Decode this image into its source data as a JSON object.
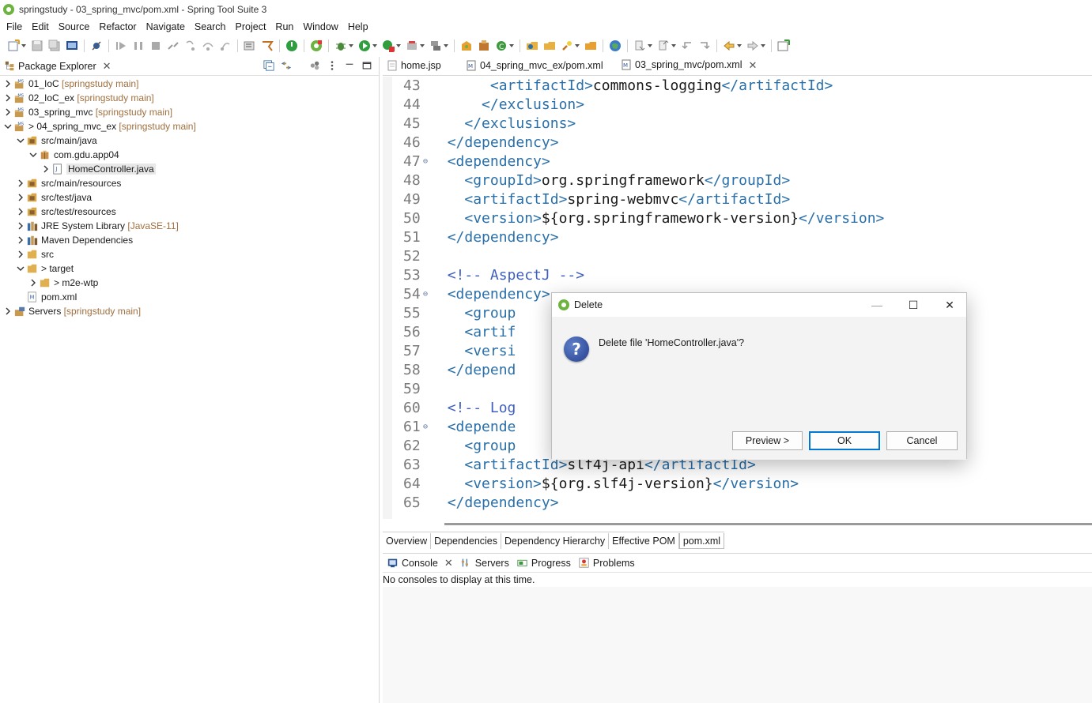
{
  "window": {
    "title": "springstudy - 03_spring_mvc/pom.xml - Spring Tool Suite 3"
  },
  "menu": [
    "File",
    "Edit",
    "Source",
    "Refactor",
    "Navigate",
    "Search",
    "Project",
    "Run",
    "Window",
    "Help"
  ],
  "package_explorer": {
    "tab_label": "Package Explorer",
    "items": [
      {
        "chevron": "›",
        "name": "01_IoC",
        "decor": " [springstudy main]",
        "icon": "maven-project-icon",
        "indent": 0
      },
      {
        "chevron": "›",
        "name": "02_IoC_ex",
        "decor": " [springstudy main]",
        "icon": "maven-project-icon",
        "indent": 0
      },
      {
        "chevron": "›",
        "name": "03_spring_mvc",
        "decor": " [springstudy main]",
        "icon": "maven-project-icon",
        "indent": 0
      },
      {
        "chevron": "⌄",
        "name": "> 04_spring_mvc_ex",
        "decor": " [springstudy main]",
        "icon": "maven-project-icon",
        "indent": 0
      },
      {
        "chevron": "⌄",
        "name": "src/main/java",
        "decor": "",
        "icon": "source-folder-icon",
        "indent": 1
      },
      {
        "chevron": "⌄",
        "name": "com.gdu.app04",
        "decor": "",
        "icon": "package-icon",
        "indent": 2
      },
      {
        "chevron": "›",
        "name": "HomeController.java",
        "decor": "",
        "icon": "java-file-icon",
        "indent": 3,
        "selected": true
      },
      {
        "chevron": "›",
        "name": "src/main/resources",
        "decor": "",
        "icon": "source-folder-icon",
        "indent": 1
      },
      {
        "chevron": "›",
        "name": "src/test/java",
        "decor": "",
        "icon": "source-folder-icon",
        "indent": 1
      },
      {
        "chevron": "›",
        "name": "src/test/resources",
        "decor": "",
        "icon": "source-folder-icon",
        "indent": 1
      },
      {
        "chevron": "›",
        "name": "JRE System Library",
        "decor": " [JavaSE-11]",
        "icon": "library-icon",
        "indent": 1
      },
      {
        "chevron": "›",
        "name": "Maven Dependencies",
        "decor": "",
        "icon": "library-icon",
        "indent": 1
      },
      {
        "chevron": "›",
        "name": "src",
        "decor": "",
        "icon": "folder-icon",
        "indent": 1
      },
      {
        "chevron": "⌄",
        "name": "> target",
        "decor": "",
        "icon": "folder-icon",
        "indent": 1
      },
      {
        "chevron": "›",
        "name": "> m2e-wtp",
        "decor": "",
        "icon": "folder-icon",
        "indent": 2
      },
      {
        "chevron": "",
        "name": "pom.xml",
        "decor": "",
        "icon": "xml-file-icon",
        "indent": 1
      },
      {
        "chevron": "›",
        "name": "Servers",
        "decor": " [springstudy main]",
        "icon": "servers-project-icon",
        "indent": 0
      }
    ]
  },
  "editor": {
    "tabs": [
      {
        "label": "home.jsp",
        "active": false,
        "closable": false
      },
      {
        "label": "04_spring_mvc_ex/pom.xml",
        "active": false,
        "closable": false
      },
      {
        "label": "03_spring_mvc/pom.xml",
        "active": true,
        "closable": true
      }
    ],
    "lines": [
      {
        "n": "43",
        "fold": false,
        "indent": "       ",
        "parts": [
          [
            "tag",
            "<artifactId>"
          ],
          [
            "txt",
            "commons-logging"
          ],
          [
            "tag",
            "</artifactId>"
          ]
        ]
      },
      {
        "n": "44",
        "fold": false,
        "indent": "      ",
        "parts": [
          [
            "tag",
            "</exclusion>"
          ]
        ]
      },
      {
        "n": "45",
        "fold": false,
        "indent": "    ",
        "parts": [
          [
            "tag",
            "</exclusions>"
          ]
        ]
      },
      {
        "n": "46",
        "fold": false,
        "indent": "  ",
        "parts": [
          [
            "tag",
            "</dependency>"
          ]
        ]
      },
      {
        "n": "47",
        "fold": true,
        "indent": "  ",
        "parts": [
          [
            "tag",
            "<dependency>"
          ]
        ]
      },
      {
        "n": "48",
        "fold": false,
        "indent": "    ",
        "parts": [
          [
            "tag",
            "<groupId>"
          ],
          [
            "txt",
            "org.springframework"
          ],
          [
            "tag",
            "</groupId>"
          ]
        ]
      },
      {
        "n": "49",
        "fold": false,
        "indent": "    ",
        "parts": [
          [
            "tag",
            "<artifactId>"
          ],
          [
            "txt",
            "spring-webmvc"
          ],
          [
            "tag",
            "</artifactId>"
          ]
        ]
      },
      {
        "n": "50",
        "fold": false,
        "indent": "    ",
        "parts": [
          [
            "tag",
            "<version>"
          ],
          [
            "txt",
            "${org.springframework-version}"
          ],
          [
            "tag",
            "</version>"
          ]
        ]
      },
      {
        "n": "51",
        "fold": false,
        "indent": "  ",
        "parts": [
          [
            "tag",
            "</dependency>"
          ]
        ]
      },
      {
        "n": "52",
        "fold": false,
        "indent": "",
        "parts": []
      },
      {
        "n": "53",
        "fold": false,
        "indent": "  ",
        "parts": [
          [
            "cmt",
            "<!-- AspectJ -->"
          ]
        ]
      },
      {
        "n": "54",
        "fold": true,
        "indent": "  ",
        "parts": [
          [
            "tag",
            "<dependency>"
          ]
        ]
      },
      {
        "n": "55",
        "fold": false,
        "indent": "    ",
        "parts": [
          [
            "tag",
            "<group"
          ]
        ]
      },
      {
        "n": "56",
        "fold": false,
        "indent": "    ",
        "parts": [
          [
            "tag",
            "<artif"
          ]
        ]
      },
      {
        "n": "57",
        "fold": false,
        "indent": "    ",
        "parts": [
          [
            "tag",
            "<versi"
          ]
        ]
      },
      {
        "n": "58",
        "fold": false,
        "indent": "  ",
        "parts": [
          [
            "tag",
            "</depend"
          ]
        ]
      },
      {
        "n": "59",
        "fold": false,
        "indent": "",
        "parts": []
      },
      {
        "n": "60",
        "fold": false,
        "indent": "  ",
        "parts": [
          [
            "cmt",
            "<!-- Log"
          ]
        ]
      },
      {
        "n": "61",
        "fold": true,
        "indent": "  ",
        "parts": [
          [
            "tag",
            "<depende"
          ]
        ]
      },
      {
        "n": "62",
        "fold": false,
        "indent": "    ",
        "parts": [
          [
            "tag",
            "<group"
          ]
        ]
      },
      {
        "n": "63",
        "fold": false,
        "indent": "    ",
        "parts": [
          [
            "tag",
            "<artifactId>"
          ],
          [
            "txt",
            "slf4j-api"
          ],
          [
            "tag",
            "</artifactId>"
          ]
        ]
      },
      {
        "n": "64",
        "fold": false,
        "indent": "    ",
        "parts": [
          [
            "tag",
            "<version>"
          ],
          [
            "txt",
            "${org.slf4j-version}"
          ],
          [
            "tag",
            "</version>"
          ]
        ]
      },
      {
        "n": "65",
        "fold": false,
        "indent": "  ",
        "parts": [
          [
            "tag",
            "</dependency>"
          ]
        ]
      }
    ],
    "pom_tabs": [
      "Overview",
      "Dependencies",
      "Dependency Hierarchy",
      "Effective POM",
      "pom.xml"
    ],
    "pom_tab_active": "pom.xml"
  },
  "bottom_panel": {
    "tabs": [
      {
        "label": "Console",
        "icon": "console-icon",
        "closable": true
      },
      {
        "label": "Servers",
        "icon": "servers-icon",
        "closable": false
      },
      {
        "label": "Progress",
        "icon": "progress-icon",
        "closable": false
      },
      {
        "label": "Problems",
        "icon": "problems-icon",
        "closable": false
      }
    ],
    "message": "No consoles to display at this time."
  },
  "dialog": {
    "title": "Delete",
    "message": "Delete file 'HomeController.java'?",
    "icon_glyph": "?",
    "buttons": {
      "preview": "Preview >",
      "ok": "OK",
      "cancel": "Cancel"
    },
    "window_controls": {
      "minimize": "—",
      "maximize": "☐",
      "close": "✕"
    }
  },
  "colors": {
    "xml_tag": "#2a6fa8",
    "xml_comment": "#3f5fbf",
    "decoration": "#a07040",
    "spring_green": "#6db33f"
  }
}
